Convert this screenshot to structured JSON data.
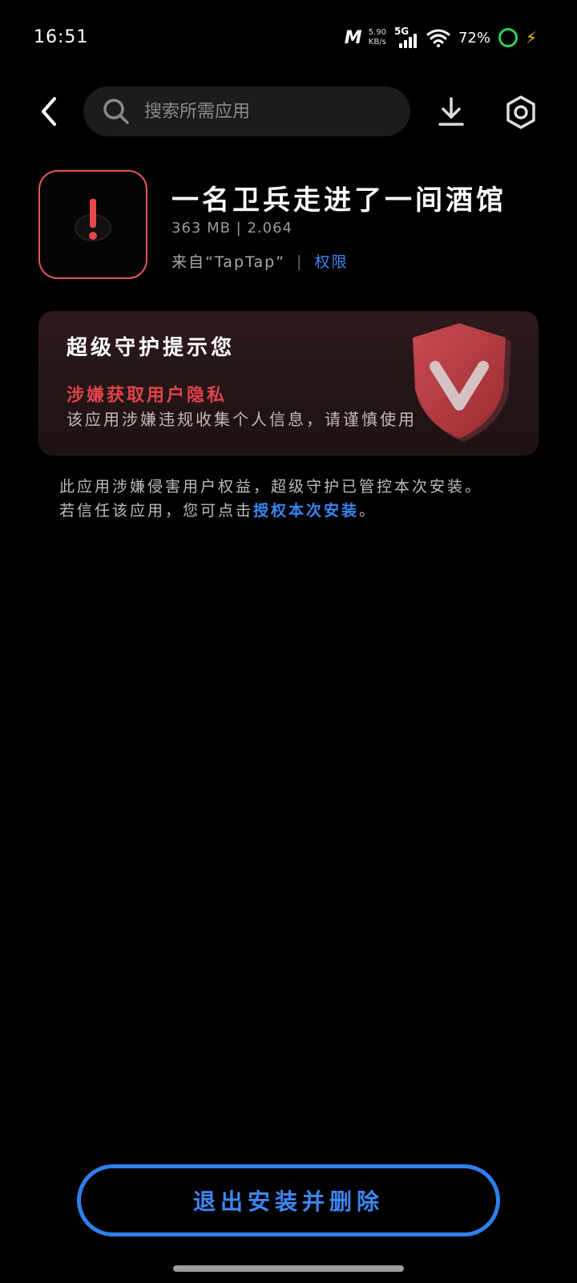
{
  "status_bar": {
    "time": "16:51",
    "net_speed_value": "5.90",
    "net_speed_unit": "KB/s",
    "network": "5G",
    "battery": "72%"
  },
  "search": {
    "placeholder": "搜索所需应用"
  },
  "app": {
    "name": "一名卫兵走进了一间酒馆",
    "meta": "363 MB | 2.064",
    "source": "来自“TapTap”",
    "permission_link": "权限"
  },
  "warning": {
    "title": "超级守护提示您",
    "risk_title": "涉嫌获取用户隐私",
    "description": "该应用涉嫌违规收集个人信息，请谨慎使用"
  },
  "notice": {
    "line1": "此应用涉嫌侵害用户权益，超级守护已管控本次安装。",
    "line2_prefix": "若信任该应用，您可点击",
    "authorize_link": "授权本次安装",
    "line2_suffix": "。"
  },
  "exit_button": "退出安装并删除",
  "colors": {
    "accent_blue": "#3d86f2",
    "danger_red": "#e2434a",
    "icon_border": "#e0575c",
    "background": "#000000"
  },
  "icons": [
    "back-icon",
    "search-icon",
    "download-icon",
    "settings-icon",
    "warning-exclamation-icon",
    "shield-icon"
  ]
}
